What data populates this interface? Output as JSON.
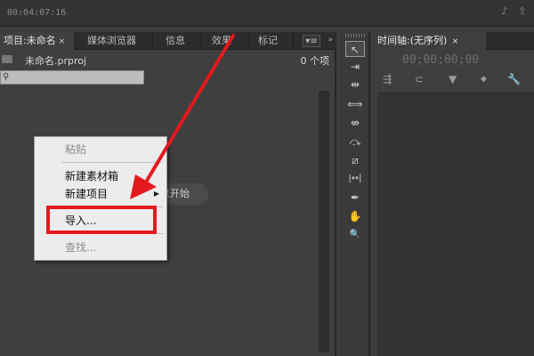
{
  "topbar": {
    "timecode": "00:04:07:16",
    "icons": [
      "audio-icon",
      "export-icon"
    ]
  },
  "project_panel": {
    "tabs": [
      {
        "label": "项目:未命名",
        "closable": true,
        "active": true
      },
      {
        "label": "媒体浏览器",
        "active": false
      },
      {
        "label": "信息",
        "active": false
      },
      {
        "label": "效果",
        "active": false
      },
      {
        "label": "标记",
        "active": false
      }
    ],
    "close_glyph": "×",
    "menu_glyph": "▾≡",
    "scroll_glyph": "»",
    "project_file": "未命名.prproj",
    "item_count": "0 个项",
    "search_placeholder": "",
    "hint_text": "以开始"
  },
  "context_menu": {
    "items": [
      {
        "label": "粘贴",
        "enabled": false
      },
      {
        "label": "新建素材箱",
        "enabled": true
      },
      {
        "label": "新建项目",
        "enabled": true,
        "submenu": true
      },
      {
        "label": "导入...",
        "enabled": true,
        "highlighted": true
      },
      {
        "label": "查找...",
        "enabled": false
      }
    ],
    "submenu_glyph": "▶"
  },
  "annotation": {
    "color": "#e3191e"
  },
  "tools": {
    "items": [
      {
        "name": "selection-tool-icon",
        "glyph": "↖"
      },
      {
        "name": "track-select-tool-icon",
        "glyph": "⇥"
      },
      {
        "name": "ripple-edit-tool-icon",
        "glyph": "⇹"
      },
      {
        "name": "rolling-edit-tool-icon",
        "glyph": "⟺"
      },
      {
        "name": "rate-stretch-tool-icon",
        "glyph": "⇎"
      },
      {
        "name": "razor-tool-icon",
        "glyph": "⤼"
      },
      {
        "name": "slip-tool-icon",
        "glyph": "⧄"
      },
      {
        "name": "slide-tool-icon",
        "glyph": "|↔|"
      },
      {
        "name": "pen-tool-icon",
        "glyph": "✒"
      },
      {
        "name": "hand-tool-icon",
        "glyph": "✋"
      },
      {
        "name": "zoom-tool-icon",
        "glyph": "🔍"
      }
    ]
  },
  "timeline": {
    "tab_label": "时间轴:(无序列)",
    "close_glyph": "×",
    "timecode": "00;00;00;00",
    "tool_icons": [
      {
        "name": "snap-icon",
        "glyph": "⇶"
      },
      {
        "name": "linked-selection-icon",
        "glyph": "⊂"
      },
      {
        "name": "add-marker-icon",
        "glyph": "▼"
      },
      {
        "name": "marker-icon",
        "glyph": "◆"
      },
      {
        "name": "wrench-icon",
        "glyph": "🔧"
      }
    ]
  }
}
